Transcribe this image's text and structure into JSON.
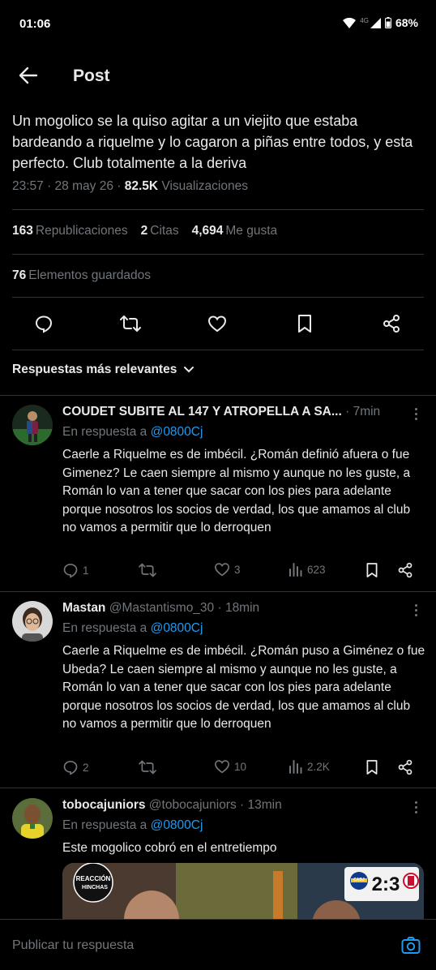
{
  "status_bar": {
    "time": "01:06",
    "network": "4G",
    "battery": "68%"
  },
  "header": {
    "title": "Post"
  },
  "post": {
    "text": "Un mogolico se la quiso agitar a un viejito que estaba bardeando a riquelme y lo cagaron a piñas entre todos, y esta perfecto. Club totalmente a la deriva",
    "timestamp": "23:57 · 28 may 26 · ",
    "views_count": "82.5K",
    "views_label": " Visualizaciones",
    "reposts_count": "163",
    "reposts_label": "Republicaciones",
    "quotes_count": "2",
    "quotes_label": "Citas",
    "likes_count": "4,694",
    "likes_label": "Me gusta",
    "bookmarks_count": "76",
    "bookmarks_label": "Elementos guardados"
  },
  "replies_sort": {
    "label": "Respuestas más relevantes"
  },
  "replies": [
    {
      "name": "COUDET SUBITE AL 147 Y ATROPELLA A SA...",
      "handle": "",
      "time": " · 7min",
      "reply_to_label": "En respuesta a ",
      "reply_to_mention": "@0800Cj",
      "text": "Caerle a Riquelme es de imbécil. ¿Román definió afuera o fue Gimenez? Le caen siempre al mismo y aunque no les guste, a Román lo van a tener que sacar con los pies para adelante porque nosotros los socios de verdad, los que amamos al club no vamos a permitir que lo derroquen",
      "replies": "1",
      "reposts": "",
      "likes": "3",
      "views": "623"
    },
    {
      "name": "Mastan",
      "handle": " @Mastantismo_30",
      "time": " · 18min",
      "reply_to_label": "En respuesta a ",
      "reply_to_mention": "@0800Cj",
      "text": "Caerle a Riquelme es de imbécil. ¿Román puso a Giménez o fue Ubeda? Le caen siempre al mismo y aunque no les guste, a Román lo van a tener que sacar con los pies para adelante porque nosotros los socios de verdad, los que amamos al club no vamos a permitir que lo derroquen",
      "replies": "2",
      "reposts": "",
      "likes": "10",
      "views": "2.2K"
    },
    {
      "name": "tobocajuniors",
      "handle": " @tobocajuniors",
      "time": " · 13min",
      "reply_to_label": "En respuesta a ",
      "reply_to_mention": "@0800Cj",
      "text": "Este mogolico cobró en el entretiempo",
      "media": {
        "badge_line1": "REACCIÓN",
        "badge_line2": "HINCHAS",
        "score": "2:3",
        "team": "CABJ"
      }
    }
  ],
  "compose": {
    "placeholder": "Publicar tu respuesta"
  },
  "colors": {
    "background": "#000000",
    "text": "#e7e9ea",
    "muted": "#71767b",
    "accent": "#1d9bf0",
    "divider": "#2f3336"
  }
}
